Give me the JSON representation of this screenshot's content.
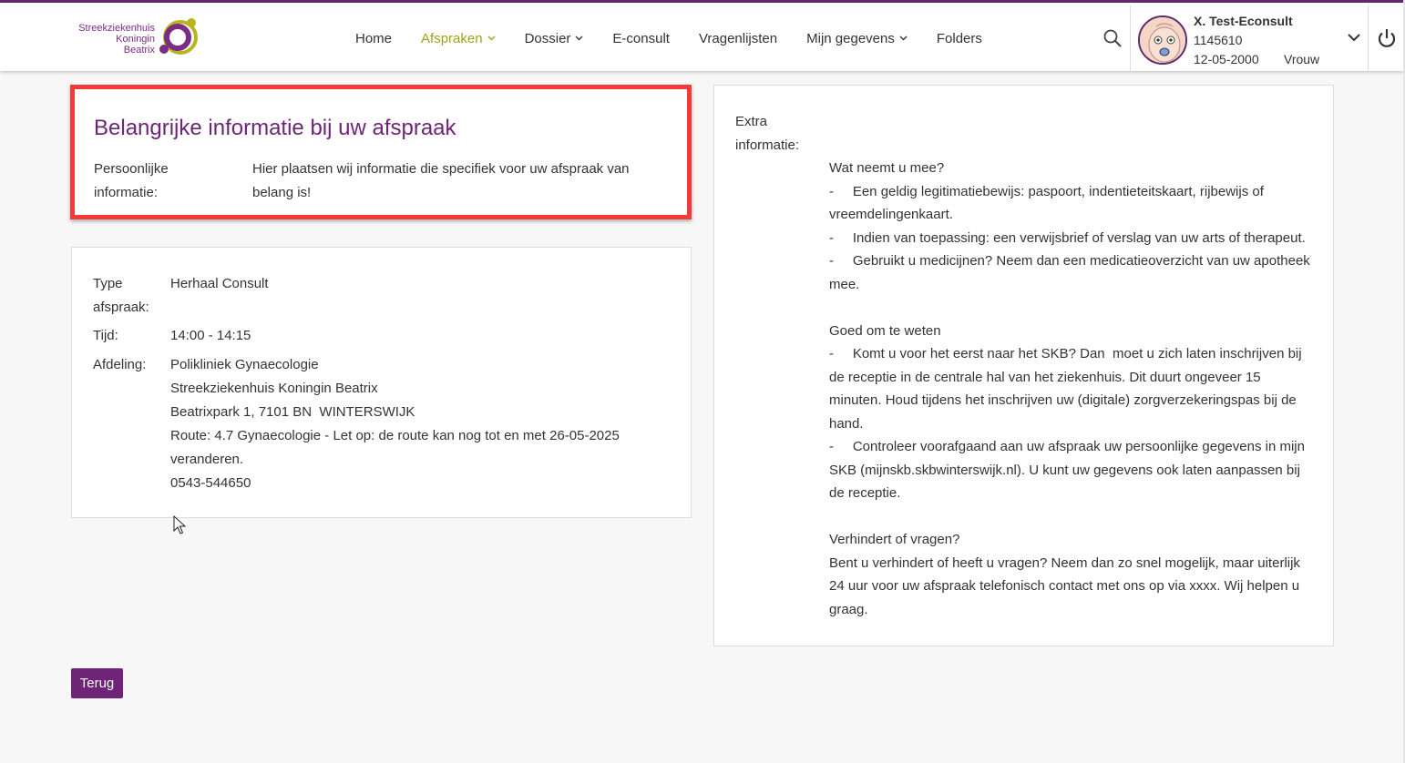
{
  "logo": {
    "line1": "Streekziekenhuis",
    "line2": "Koningin",
    "line3": "Beatrix"
  },
  "nav": [
    {
      "label": "Home",
      "dropdown": false,
      "active": false
    },
    {
      "label": "Afspraken",
      "dropdown": true,
      "active": true
    },
    {
      "label": "Dossier",
      "dropdown": true,
      "active": false
    },
    {
      "label": "E-consult",
      "dropdown": false,
      "active": false
    },
    {
      "label": "Vragenlijsten",
      "dropdown": false,
      "active": false
    },
    {
      "label": "Mijn gegevens",
      "dropdown": true,
      "active": false
    },
    {
      "label": "Folders",
      "dropdown": false,
      "active": false
    }
  ],
  "user": {
    "name": "X. Test-Econsult",
    "id": "1145610",
    "dob": "12-05-2000",
    "gender": "Vrouw"
  },
  "important": {
    "title": "Belangrijke informatie bij uw afspraak",
    "label_line1": "Persoonlijke",
    "label_line2": "informatie:",
    "text_line1": "Hier plaatsen wij informatie die specifiek voor uw afspraak van",
    "text_line2": "belang is!"
  },
  "details": {
    "type_label_line1": "Type",
    "type_label_line2": "afspraak:",
    "type_value": "Herhaal Consult",
    "time_label": "Tijd:",
    "time_value": "14:00 - 14:15",
    "dept_label": "Afdeling:",
    "dept_lines": [
      "Polikliniek Gynaecologie",
      "Streekziekenhuis Koningin Beatrix",
      "Beatrixpark 1, 7101 BN  WINTERSWIJK",
      "Route: 4.7 Gynaecologie - Let op: de route kan nog tot en met 26-05-2025",
      "veranderen.",
      "0543-544650"
    ]
  },
  "extra": {
    "label_line1": "Extra",
    "label_line2": "informatie:",
    "lines": [
      "Wat neemt u mee?",
      "-     Een geldig legitimatiebewijs: paspoort, indentieteitskaart, rijbewijs of",
      "vreemdelingenkaart.",
      "-     Indien van toepassing: een verwijsbrief of verslag van uw arts of therapeut.",
      "-     Gebruikt u medicijnen? Neem dan een medicatieoverzicht van uw apotheek",
      "mee.",
      "",
      "Goed om te weten",
      "-     Komt u voor het eerst naar het SKB? Dan  moet u zich laten inschrijven bij",
      "de receptie in de centrale hal van het ziekenhuis. Dit duurt ongeveer 15",
      "minuten. Houd tijdens het inschrijven uw (digitale) zorgverzekeringspas bij de",
      "hand.",
      "-     Controleer voorafgaand aan uw afspraak uw persoonlijke gegevens in mijn",
      "SKB (mijnskb.skbwinterswijk.nl). U kunt uw gegevens ook laten aanpassen bij",
      "de receptie.",
      "",
      "Verhindert of vragen?",
      "Bent u verhindert of heeft u vragen? Neem dan zo snel mogelijk, maar uiterlijk",
      "24 uur voor uw afspraak telefonisch contact met ons op via xxxx. Wij helpen u",
      "graag."
    ]
  },
  "back_button": "Terug"
}
